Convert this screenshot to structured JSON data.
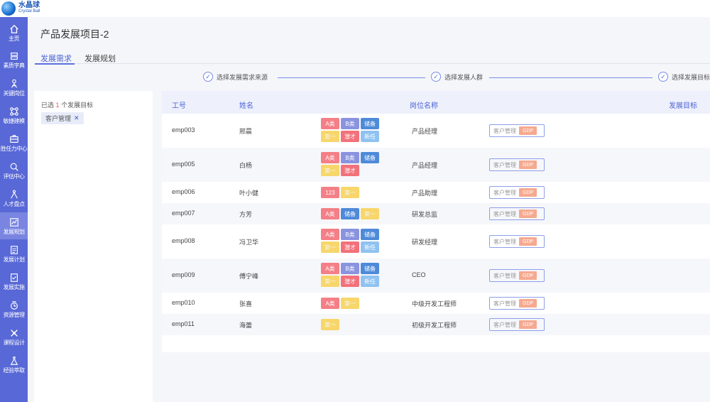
{
  "brand": {
    "name": "水晶球",
    "sub": "Crystal Ball"
  },
  "nav": [
    {
      "label": "主页",
      "icon": "home-icon"
    },
    {
      "label": "素质字典",
      "icon": "dictionary-icon"
    },
    {
      "label": "关键岗位",
      "icon": "key-position-icon"
    },
    {
      "label": "敏捷建模",
      "icon": "modeling-icon"
    },
    {
      "label": "胜任力中心",
      "icon": "competency-icon"
    },
    {
      "label": "评估中心",
      "icon": "assessment-icon"
    },
    {
      "label": "人才盘点",
      "icon": "talent-review-icon"
    },
    {
      "label": "发展规划",
      "icon": "development-plan-icon",
      "active": true
    },
    {
      "label": "发展计划",
      "icon": "plan-icon"
    },
    {
      "label": "发展实施",
      "icon": "implementation-icon"
    },
    {
      "label": "资源管理",
      "icon": "resource-icon"
    },
    {
      "label": "课程设计",
      "icon": "course-icon"
    },
    {
      "label": "经验萃取",
      "icon": "experience-icon"
    }
  ],
  "page": {
    "title": "产品发展项目-2"
  },
  "tabs": [
    {
      "label": "发展需求",
      "active": true
    },
    {
      "label": "发展规划",
      "active": false
    }
  ],
  "steps": [
    {
      "label": "选择发展需求来源"
    },
    {
      "label": "选择发展人群"
    },
    {
      "label": "选择发展目标"
    }
  ],
  "selection": {
    "prefix": "已选",
    "count": "1",
    "suffix": "个发展目标",
    "chip": "客户管理",
    "chip_close": "✕"
  },
  "table": {
    "headers": {
      "id": "工号",
      "name": "姓名",
      "position": "岗位名称",
      "goal": "发展目标"
    },
    "rows": [
      {
        "id": "emp003",
        "name": "邢晨",
        "tags": [
          "A类",
          "B类",
          "储备",
          "第一",
          "潜才",
          "新任"
        ],
        "position": "产品经理",
        "goal": "客户管理",
        "goal_tag": "GDP"
      },
      {
        "id": "emp005",
        "name": "白杨",
        "tags": [
          "A类",
          "B类",
          "储备",
          "第一",
          "潜才"
        ],
        "position": "产品经理",
        "goal": "客户管理",
        "goal_tag": "GDP"
      },
      {
        "id": "emp006",
        "name": "叶小健",
        "tags": [
          "123",
          "第一"
        ],
        "position": "产品助理",
        "goal": "客户管理",
        "goal_tag": "GDP"
      },
      {
        "id": "emp007",
        "name": "方芳",
        "tags": [
          "A类",
          "储备",
          "第一"
        ],
        "position": "研发总监",
        "goal": "客户管理",
        "goal_tag": "GDP"
      },
      {
        "id": "emp008",
        "name": "冯卫华",
        "tags": [
          "A类",
          "B类",
          "储备",
          "第一",
          "潜才",
          "新任"
        ],
        "position": "研发经理",
        "goal": "客户管理",
        "goal_tag": "GDP"
      },
      {
        "id": "emp009",
        "name": "傅宁峰",
        "tags": [
          "A类",
          "B类",
          "储备",
          "第一",
          "潜才",
          "新任"
        ],
        "position": "CEO",
        "goal": "客户管理",
        "goal_tag": "GDP"
      },
      {
        "id": "emp010",
        "name": "张喜",
        "tags": [
          "A类",
          "第一"
        ],
        "position": "中级开发工程师",
        "goal": "客户管理",
        "goal_tag": "GDP"
      },
      {
        "id": "emp011",
        "name": "海蕾",
        "tags": [
          "第一"
        ],
        "position": "初级开发工程师",
        "goal": "客户管理",
        "goal_tag": "GDP"
      }
    ]
  }
}
